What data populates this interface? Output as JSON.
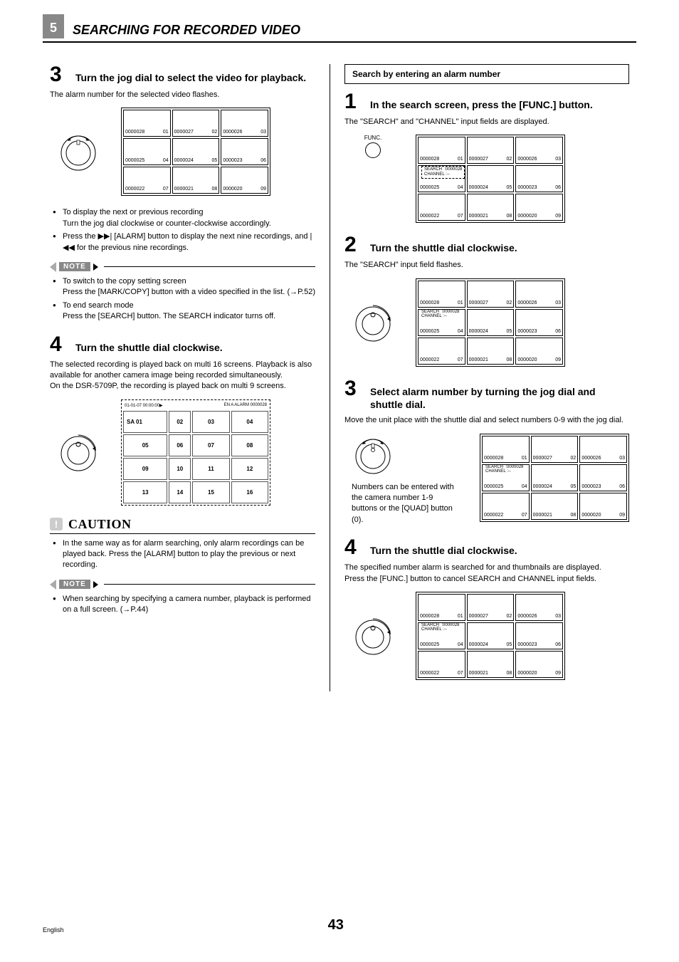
{
  "header": {
    "section_number": "5",
    "title": "SEARCHING FOR RECORDED VIDEO"
  },
  "left": {
    "step3": {
      "num": "3",
      "title": "Turn the jog dial to select the video for playback.",
      "desc": "The alarm number for the selected video flashes.",
      "bullets": [
        "To display the next or previous recording\nTurn the jog dial clockwise or counter-clockwise accordingly.",
        "Press the ▶▶| [ALARM] button to display the next nine recordings, and |◀◀ for the previous nine recordings."
      ]
    },
    "note1": {
      "label": "NOTE",
      "items": [
        "To switch to the copy setting screen\nPress the [MARK/COPY] button with a video specified in the list. (→P.52)",
        "To end search mode\nPress the [SEARCH] button. The SEARCH indicator turns off."
      ]
    },
    "step4": {
      "num": "4",
      "title": "Turn the shuttle dial clockwise.",
      "desc": "The selected recording is played back on multi 16 screens. Playback is also available for another camera image being recorded simultaneously.\nOn the DSR-5709P, the recording is played back on multi 9 screens."
    },
    "multi": {
      "header_left": "01-01-07 00:00:00▶",
      "header_right": "EN A ALARM 0000028",
      "sa": "SA   01",
      "cells": [
        "02",
        "03",
        "04",
        "05",
        "06",
        "07",
        "08",
        "09",
        "10",
        "11",
        "12",
        "13",
        "14",
        "15",
        "16"
      ]
    },
    "caution": {
      "label": "CAUTION",
      "items": [
        "In the same way as for alarm searching, only alarm recordings can be played back. Press the [ALARM] button to play the previous or next recording."
      ]
    },
    "note2": {
      "label": "NOTE",
      "items": [
        "When searching by specifying a camera number, playback is performed on a full screen. (→P.44)"
      ]
    }
  },
  "right": {
    "search_box": "Search by entering an alarm number",
    "step1": {
      "num": "1",
      "title": "In the search screen, press the [FUNC.] button.",
      "desc": "The \"SEARCH\" and \"CHANNEL\" input fields are displayed.",
      "func_label": "FUNC.",
      "overlay": "SEARCH  :0000028\nCHANNEL :--"
    },
    "step2": {
      "num": "2",
      "title": "Turn the shuttle dial clockwise.",
      "desc": "The \"SEARCH\" input field flashes.",
      "overlay": "SEARCH  :0000028\nCHANNEL :--"
    },
    "step3": {
      "num": "3",
      "title": "Select alarm number by turning the jog dial and shuttle dial.",
      "desc": "Move the unit place with the shuttle dial and select numbers 0-9 with the jog dial.",
      "side_note": "Numbers can be entered with the camera number 1-9 buttons or the [QUAD] button (0).",
      "overlay": "SEARCH  :0000028\nCHANNEL :--"
    },
    "step4": {
      "num": "4",
      "title": "Turn the shuttle dial clockwise.",
      "desc": "The specified number alarm is searched for and thumbnails are displayed.\nPress the [FUNC.] button to cancel SEARCH and CHANNEL input fields.",
      "overlay": "SEARCH  :0000028\nCHANNEL :--"
    },
    "thumb": {
      "r1": [
        {
          "t": "0000028",
          "n": "01"
        },
        {
          "t": "0000027",
          "n": "02"
        },
        {
          "t": "0000026",
          "n": "03"
        }
      ],
      "r2": [
        {
          "t": "0000025",
          "n": "04"
        },
        {
          "t": "0000024",
          "n": "05"
        },
        {
          "t": "0000023",
          "n": "06"
        }
      ],
      "r3": [
        {
          "t": "0000022",
          "n": "07"
        },
        {
          "t": "0000021",
          "n": "08"
        },
        {
          "t": "0000020",
          "n": "09"
        }
      ]
    }
  },
  "footer": {
    "lang": "English",
    "page": "43"
  }
}
